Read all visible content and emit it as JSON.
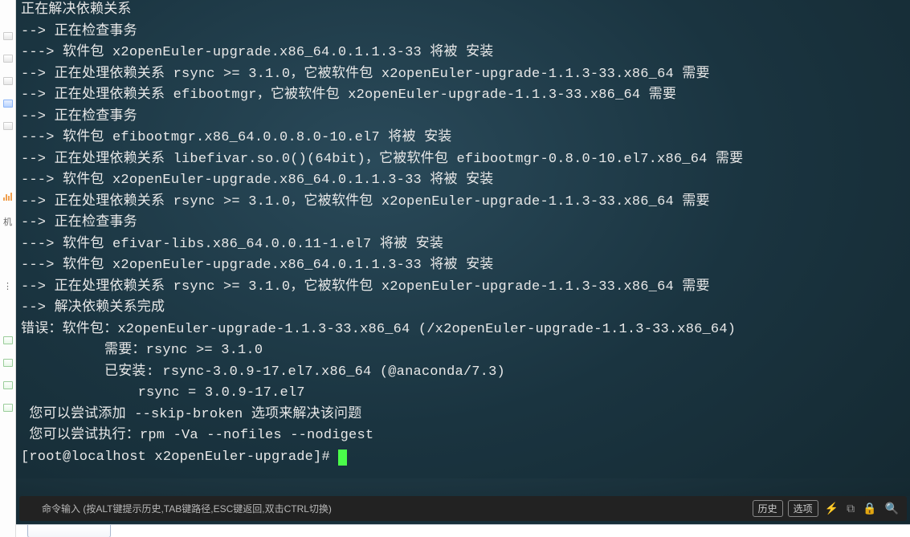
{
  "terminal": {
    "lines": [
      "正在解决依赖关系",
      "--> 正在检查事务",
      "---> 软件包 x2openEuler-upgrade.x86_64.0.1.1.3-33 将被 安装",
      "--> 正在处理依赖关系 rsync >= 3.1.0，它被软件包 x2openEuler-upgrade-1.1.3-33.x86_64 需要",
      "--> 正在处理依赖关系 efibootmgr，它被软件包 x2openEuler-upgrade-1.1.3-33.x86_64 需要",
      "--> 正在检查事务",
      "---> 软件包 efibootmgr.x86_64.0.0.8.0-10.el7 将被 安装",
      "--> 正在处理依赖关系 libefivar.so.0()(64bit)，它被软件包 efibootmgr-0.8.0-10.el7.x86_64 需要",
      "---> 软件包 x2openEuler-upgrade.x86_64.0.1.1.3-33 将被 安装",
      "--> 正在处理依赖关系 rsync >= 3.1.0，它被软件包 x2openEuler-upgrade-1.1.3-33.x86_64 需要",
      "--> 正在检查事务",
      "---> 软件包 efivar-libs.x86_64.0.0.11-1.el7 将被 安装",
      "---> 软件包 x2openEuler-upgrade.x86_64.0.1.1.3-33 将被 安装",
      "--> 正在处理依赖关系 rsync >= 3.1.0，它被软件包 x2openEuler-upgrade-1.1.3-33.x86_64 需要",
      "--> 解决依赖关系完成",
      "错误：软件包：x2openEuler-upgrade-1.1.3-33.x86_64 (/x2openEuler-upgrade-1.1.3-33.x86_64)",
      "          需要：rsync >= 3.1.0",
      "          已安装: rsync-3.0.9-17.el7.x86_64 (@anaconda/7.3)",
      "              rsync = 3.0.9-17.el7",
      " 您可以尝试添加 --skip-broken 选项来解决该问题",
      " 您可以尝试执行：rpm -Va --nofiles --nodigest"
    ],
    "prompt": "[root@localhost x2openEuler-upgrade]# "
  },
  "status_bar": {
    "hint": "命令输入 (按ALT键提示历史,TAB键路径,ESC键返回,双击CTRL切换)",
    "history": "历史",
    "options": "选项"
  },
  "left_strip": {
    "label_machine": "机"
  }
}
